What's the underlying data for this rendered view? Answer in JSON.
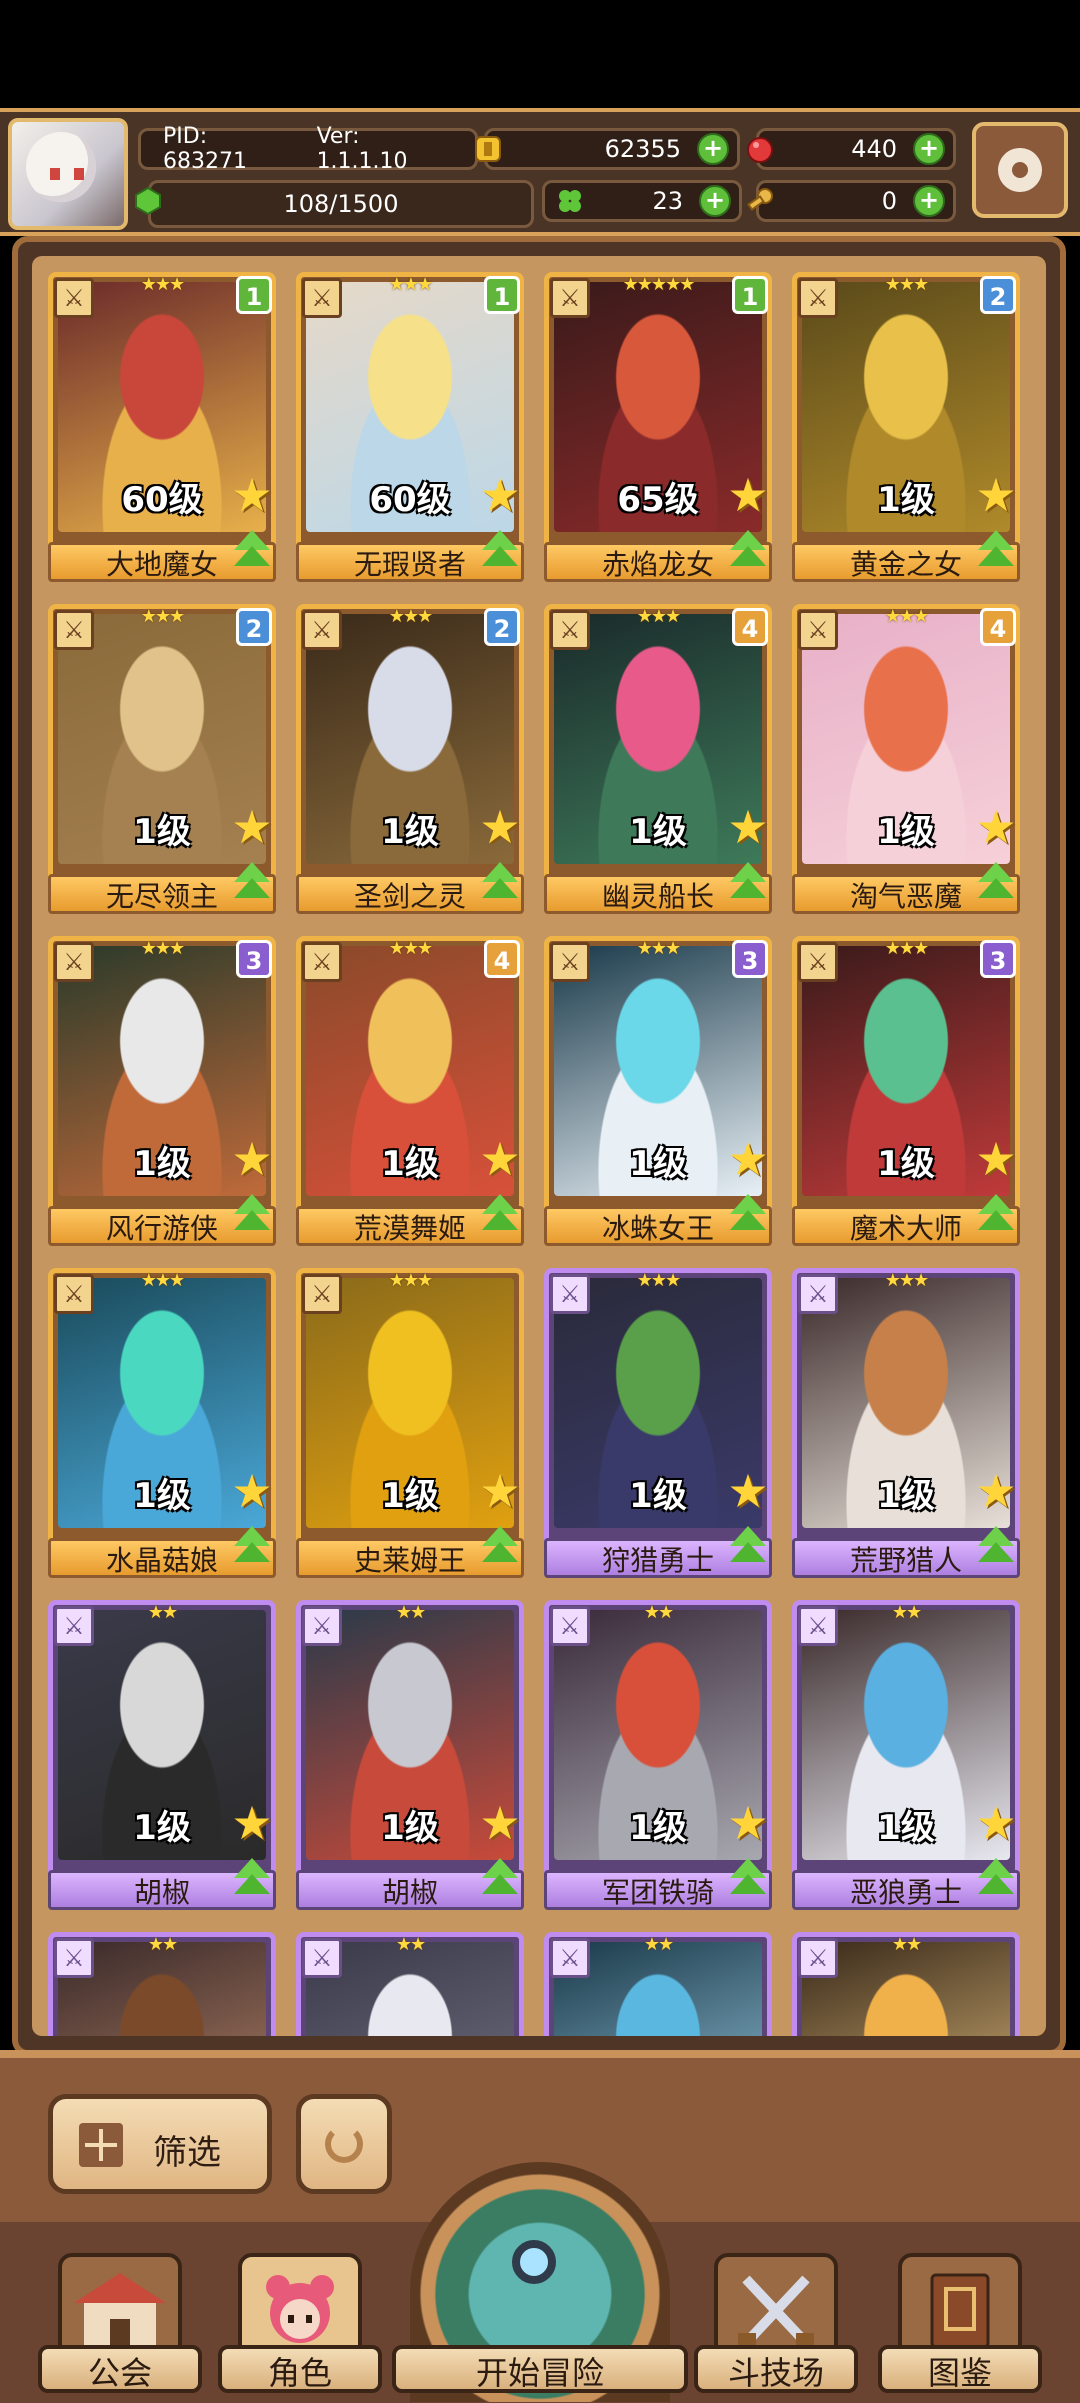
{
  "header": {
    "pid_label": "PID: 683271",
    "version_label": "Ver: 1.1.1.10",
    "coins": "62355",
    "rubies": "440",
    "stamina": "108/1500",
    "clovers": "23",
    "keys": "0"
  },
  "heroes": [
    {
      "name": "大地魔女",
      "level": "60级",
      "badge": "1",
      "stars": "★★★",
      "rarity": "gold",
      "colors": [
        "#6b2a2a",
        "#c8463a",
        "#e8b04a"
      ]
    },
    {
      "name": "无瑕贤者",
      "level": "60级",
      "badge": "1",
      "stars": "★★★",
      "rarity": "gold",
      "colors": [
        "#e6d9c8",
        "#f6e08a",
        "#bcd7e8"
      ]
    },
    {
      "name": "赤焰龙女",
      "level": "65级",
      "badge": "1",
      "stars": "★★★★★",
      "rarity": "gold",
      "colors": [
        "#3a1a1a",
        "#d8583c",
        "#8a2a2a"
      ]
    },
    {
      "name": "黄金之女",
      "level": "1级",
      "badge": "2",
      "stars": "★★★",
      "rarity": "gold",
      "colors": [
        "#5a4a1a",
        "#e8c04a",
        "#b08a2a"
      ]
    },
    {
      "name": "无尽领主",
      "level": "1级",
      "badge": "2",
      "stars": "★★★",
      "rarity": "gold",
      "colors": [
        "#8a6a3a",
        "#e0c28a",
        "#a58050"
      ]
    },
    {
      "name": "圣剑之灵",
      "level": "1级",
      "badge": "2",
      "stars": "★★★",
      "rarity": "gold",
      "colors": [
        "#3a2a1a",
        "#d8dce8",
        "#8a6a3a"
      ]
    },
    {
      "name": "幽灵船长",
      "level": "1级",
      "badge": "4",
      "stars": "★★★",
      "rarity": "gold",
      "colors": [
        "#1a2a2a",
        "#e85a8a",
        "#3e7a5a"
      ]
    },
    {
      "name": "淘气恶魔",
      "level": "1级",
      "badge": "4",
      "stars": "★★★",
      "rarity": "gold",
      "colors": [
        "#e8b0c8",
        "#e8704a",
        "#f6d0d8"
      ]
    },
    {
      "name": "风行游侠",
      "level": "1级",
      "badge": "3",
      "stars": "★★★",
      "rarity": "gold",
      "colors": [
        "#2a3a2a",
        "#e8e8e8",
        "#c06a3a"
      ]
    },
    {
      "name": "荒漠舞姬",
      "level": "1级",
      "badge": "4",
      "stars": "★★★",
      "rarity": "gold",
      "colors": [
        "#8a4a2a",
        "#f0c05a",
        "#d8503a"
      ]
    },
    {
      "name": "冰蛛女王",
      "level": "1级",
      "badge": "3",
      "stars": "★★★",
      "rarity": "gold",
      "colors": [
        "#1a3a4a",
        "#6ad8e8",
        "#e8f0f6"
      ]
    },
    {
      "name": "魔术大师",
      "level": "1级",
      "badge": "3",
      "stars": "★★★",
      "rarity": "gold",
      "colors": [
        "#3a1a1a",
        "#5ac090",
        "#c03a3a"
      ]
    },
    {
      "name": "水晶菇娘",
      "level": "1级",
      "badge": "",
      "stars": "★★★",
      "rarity": "gold",
      "colors": [
        "#1a4a5a",
        "#4ad8c0",
        "#4aa8d8"
      ]
    },
    {
      "name": "史莱姆王",
      "level": "1级",
      "badge": "",
      "stars": "★★★",
      "rarity": "gold",
      "colors": [
        "#8a6a1a",
        "#f0c020",
        "#e0a010"
      ]
    },
    {
      "name": "狩猎勇士",
      "level": "1级",
      "badge": "",
      "stars": "★★★",
      "rarity": "purple",
      "colors": [
        "#2a2a3a",
        "#5aa04a",
        "#3a3a6a"
      ]
    },
    {
      "name": "荒野猎人",
      "level": "1级",
      "badge": "",
      "stars": "★★★",
      "rarity": "purple",
      "colors": [
        "#3a2a2a",
        "#c8804a",
        "#e8e0d8"
      ]
    },
    {
      "name": "胡椒",
      "level": "1级",
      "badge": "",
      "stars": "★★",
      "rarity": "purple",
      "colors": [
        "#3a3a4a",
        "#d8d8d8",
        "#2a2a2a"
      ]
    },
    {
      "name": "胡椒",
      "level": "1级",
      "badge": "",
      "stars": "★★",
      "rarity": "purple",
      "colors": [
        "#2a3a4a",
        "#c8c8d0",
        "#c84a3a"
      ]
    },
    {
      "name": "军团铁骑",
      "level": "1级",
      "badge": "",
      "stars": "★★",
      "rarity": "purple",
      "colors": [
        "#3a2a3a",
        "#d8503a",
        "#a8a8b0"
      ]
    },
    {
      "name": "恶狼勇士",
      "level": "1级",
      "badge": "",
      "stars": "★★",
      "rarity": "purple",
      "colors": [
        "#3a2a2a",
        "#5ab0e0",
        "#e8e8f0"
      ]
    },
    {
      "name": "",
      "level": "",
      "badge": "",
      "stars": "★★",
      "rarity": "purple",
      "colors": [
        "#3a2a2a",
        "#7a4a2a",
        "#c89070"
      ]
    },
    {
      "name": "",
      "level": "",
      "badge": "",
      "stars": "★★",
      "rarity": "purple",
      "colors": [
        "#3a3a4a",
        "#e8e8f0",
        "#7a7a8a"
      ]
    },
    {
      "name": "",
      "level": "",
      "badge": "",
      "stars": "★★",
      "rarity": "purple",
      "colors": [
        "#1a3a4a",
        "#5ab8e0",
        "#a8d8f0"
      ]
    },
    {
      "name": "",
      "level": "",
      "badge": "",
      "stars": "★★",
      "rarity": "purple",
      "colors": [
        "#3a2a1a",
        "#f0b04a",
        "#f6d08a"
      ]
    }
  ],
  "controls": {
    "filter_label": "筛选"
  },
  "nav": {
    "guild": "公会",
    "characters": "角色",
    "adventure": "开始冒险",
    "arena": "斗技场",
    "codex": "图鉴"
  }
}
